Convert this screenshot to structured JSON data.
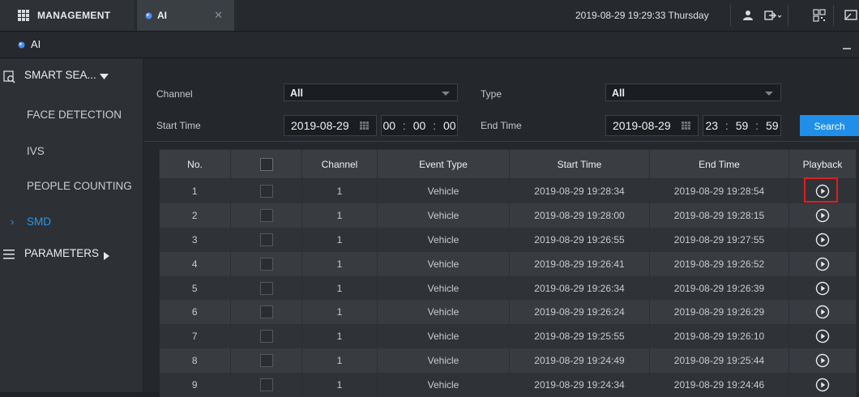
{
  "topbar": {
    "management_label": "MANAGEMENT",
    "active_tab_label": "AI",
    "datetime": "2019-08-29 19:29:33 Thursday",
    "user_icon": "user-icon",
    "logout_icon": "logout-icon",
    "qr_icon": "qr-code-icon",
    "window_icon": "window-icon"
  },
  "title": {
    "label": "AI"
  },
  "sidebar": {
    "smart_search_label": "SMART SEA...",
    "items": [
      {
        "label": "FACE DETECTION",
        "active": false
      },
      {
        "label": "IVS",
        "active": false
      },
      {
        "label": "PEOPLE COUNTING",
        "active": false
      },
      {
        "label": "SMD",
        "active": true
      }
    ],
    "parameters_label": "PARAMETERS"
  },
  "filters": {
    "channel_label": "Channel",
    "channel_value": "All",
    "type_label": "Type",
    "type_value": "All",
    "start_time_label": "Start Time",
    "start_date": "2019-08-29",
    "start_h": "00",
    "start_m": "00",
    "start_s": "00",
    "end_time_label": "End Time",
    "end_date": "2019-08-29",
    "end_h": "23",
    "end_m": "59",
    "end_s": "59",
    "search_label": "Search"
  },
  "table": {
    "headers": [
      "No.",
      "",
      "Channel",
      "Event Type",
      "Start Time",
      "End Time",
      "Playback"
    ],
    "rows": [
      {
        "no": "1",
        "channel": "1",
        "event": "Vehicle",
        "start": "2019-08-29 19:28:34",
        "end": "2019-08-29 19:28:54"
      },
      {
        "no": "2",
        "channel": "1",
        "event": "Vehicle",
        "start": "2019-08-29 19:28:00",
        "end": "2019-08-29 19:28:15"
      },
      {
        "no": "3",
        "channel": "1",
        "event": "Vehicle",
        "start": "2019-08-29 19:26:55",
        "end": "2019-08-29 19:27:55"
      },
      {
        "no": "4",
        "channel": "1",
        "event": "Vehicle",
        "start": "2019-08-29 19:26:41",
        "end": "2019-08-29 19:26:52"
      },
      {
        "no": "5",
        "channel": "1",
        "event": "Vehicle",
        "start": "2019-08-29 19:26:34",
        "end": "2019-08-29 19:26:39"
      },
      {
        "no": "6",
        "channel": "1",
        "event": "Vehicle",
        "start": "2019-08-29 19:26:24",
        "end": "2019-08-29 19:26:29"
      },
      {
        "no": "7",
        "channel": "1",
        "event": "Vehicle",
        "start": "2019-08-29 19:25:55",
        "end": "2019-08-29 19:26:10"
      },
      {
        "no": "8",
        "channel": "1",
        "event": "Vehicle",
        "start": "2019-08-29 19:24:49",
        "end": "2019-08-29 19:25:44"
      },
      {
        "no": "9",
        "channel": "1",
        "event": "Vehicle",
        "start": "2019-08-29 19:24:34",
        "end": "2019-08-29 19:24:46"
      }
    ],
    "highlighted_playback_row": 0
  },
  "colors": {
    "accent": "#1f8fea",
    "active_nav": "#2b94ea",
    "highlight_box": "#e01e1e"
  }
}
